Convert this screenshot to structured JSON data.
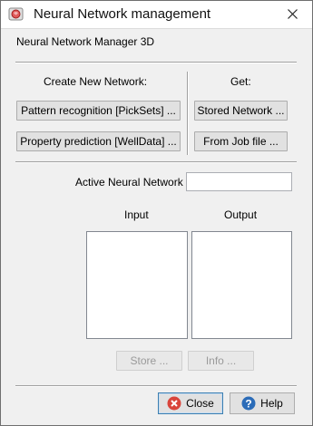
{
  "window": {
    "title": "Neural Network management",
    "header": "Neural Network Manager 3D"
  },
  "create": {
    "label": "Create New Network:",
    "pattern_btn": "Pattern recognition [PickSets] ...",
    "property_btn": "Property prediction [WellData] ..."
  },
  "get": {
    "label": "Get:",
    "stored_btn": "Stored Network ...",
    "jobfile_btn": "From Job file ..."
  },
  "active": {
    "label": "Active Neural Network",
    "value": ""
  },
  "lists": {
    "input_label": "Input",
    "output_label": "Output"
  },
  "actions": {
    "store_btn": "Store ...",
    "info_btn": "Info ..."
  },
  "footer": {
    "close_btn": "Close",
    "help_btn": "Help"
  },
  "colors": {
    "close_icon": "#d9443a",
    "help_icon": "#2b6cb8"
  }
}
